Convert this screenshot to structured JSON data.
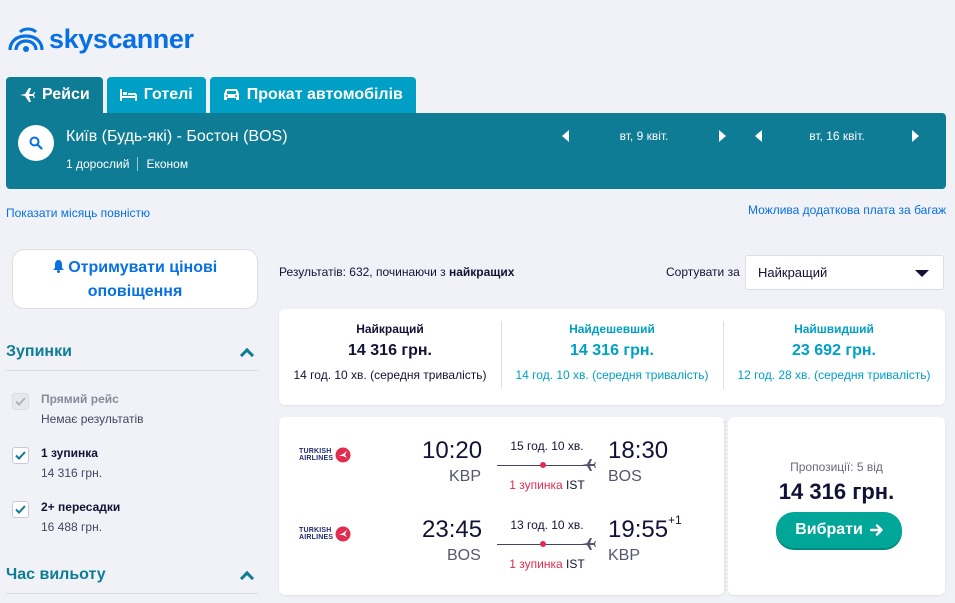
{
  "brand": {
    "logo_text": "skyscanner",
    "color": "#0770e3"
  },
  "tabs": [
    {
      "label": "Рейси",
      "icon": "plane-icon",
      "active": true
    },
    {
      "label": "Готелі",
      "icon": "bed-icon",
      "active": false
    },
    {
      "label": "Прокат автомобілів",
      "icon": "car-icon",
      "active": false
    }
  ],
  "search": {
    "route": "Київ (Будь-які) - Бостон (BOS)",
    "passengers": "1 дорослий",
    "cabin": "Економ",
    "depart_date": "вт, 9 квіт.",
    "return_date": "вт, 16 квіт."
  },
  "links": {
    "show_month": "Показати місяць повністю",
    "baggage_fee": "Можлива додаткова плата за багаж"
  },
  "sidebar": {
    "alert_button": "Отримувати цінові оповіщення",
    "stops_title": "Зупинки",
    "stops": [
      {
        "label": "Прямий рейс",
        "sub": "Немає результатів",
        "checked": true,
        "disabled": true
      },
      {
        "label": "1 зупинка",
        "sub": "14 316 грн.",
        "checked": true,
        "disabled": false
      },
      {
        "label": "2+ пересадки",
        "sub": "16 488 грн.",
        "checked": true,
        "disabled": false
      }
    ],
    "departure_time_title": "Час вильоту"
  },
  "results": {
    "info_prefix": "Результатів: 632, починаючи з ",
    "info_bold": "найкращих",
    "sort_label": "Сортувати за",
    "sort_value": "Найкращий"
  },
  "sort_tabs": [
    {
      "title": "Найкращий",
      "price": "14 316 грн.",
      "duration": "14 год. 10 хв. (середня тривалість)",
      "active": true
    },
    {
      "title": "Найдешевший",
      "price": "14 316 грн.",
      "duration": "14 год. 10 хв. (середня тривалість)",
      "active": false
    },
    {
      "title": "Найшвидший",
      "price": "23 692 грн.",
      "duration": "12 год. 28 хв. (середня тривалість)",
      "active": false
    }
  ],
  "ticket": {
    "airline": {
      "line1": "TURKISH",
      "line2": "AIRLINES"
    },
    "legs": [
      {
        "dep_time": "10:20",
        "dep_code": "KBP",
        "duration": "15 год. 10 хв.",
        "stops": "1 зупинка",
        "via": "IST",
        "arr_time": "18:30",
        "arr_code": "BOS",
        "plus": ""
      },
      {
        "dep_time": "23:45",
        "dep_code": "BOS",
        "duration": "13 год. 10 хв.",
        "stops": "1 зупинка",
        "via": "IST",
        "arr_time": "19:55",
        "arr_code": "KBP",
        "plus": "+1"
      }
    ],
    "offers": "Пропозиції: 5 від",
    "price": "14 316 грн.",
    "select_label": "Вибрати"
  }
}
